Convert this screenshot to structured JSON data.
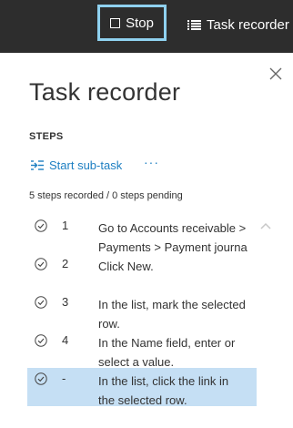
{
  "topbar": {
    "stop_label": "Stop",
    "recorder_label": "Task recorder",
    "stop_icon": "stop-square-icon",
    "recorder_icon": "list-icon",
    "accent_border": "#8fd1ef",
    "background": "#2d2d2d"
  },
  "panel": {
    "title": "Task recorder",
    "close_icon": "close-icon",
    "steps_header": "STEPS",
    "start_subtask_label": "Start sub-task",
    "start_subtask_icon": "indent-icon",
    "more_label": "···",
    "status_text": "5 steps recorded / 0 steps pending",
    "link_color": "#1e7fc2",
    "selected_color": "#c5dff4"
  },
  "steps": [
    {
      "num": "1",
      "line1": "Go to Accounts receivable >",
      "line2": "Payments > Payment journa",
      "selected": false
    },
    {
      "num": "2",
      "line1": "Click New.",
      "line2": "",
      "selected": false
    },
    {
      "num": "3",
      "line1": "In the list, mark the selected",
      "line2": "row.",
      "selected": false
    },
    {
      "num": "4",
      "line1": "In the Name field, enter or",
      "line2": "select a value.",
      "selected": false
    },
    {
      "num": "-",
      "line1": "In the list, click the link in",
      "line2": "the selected row.",
      "selected": true
    }
  ]
}
